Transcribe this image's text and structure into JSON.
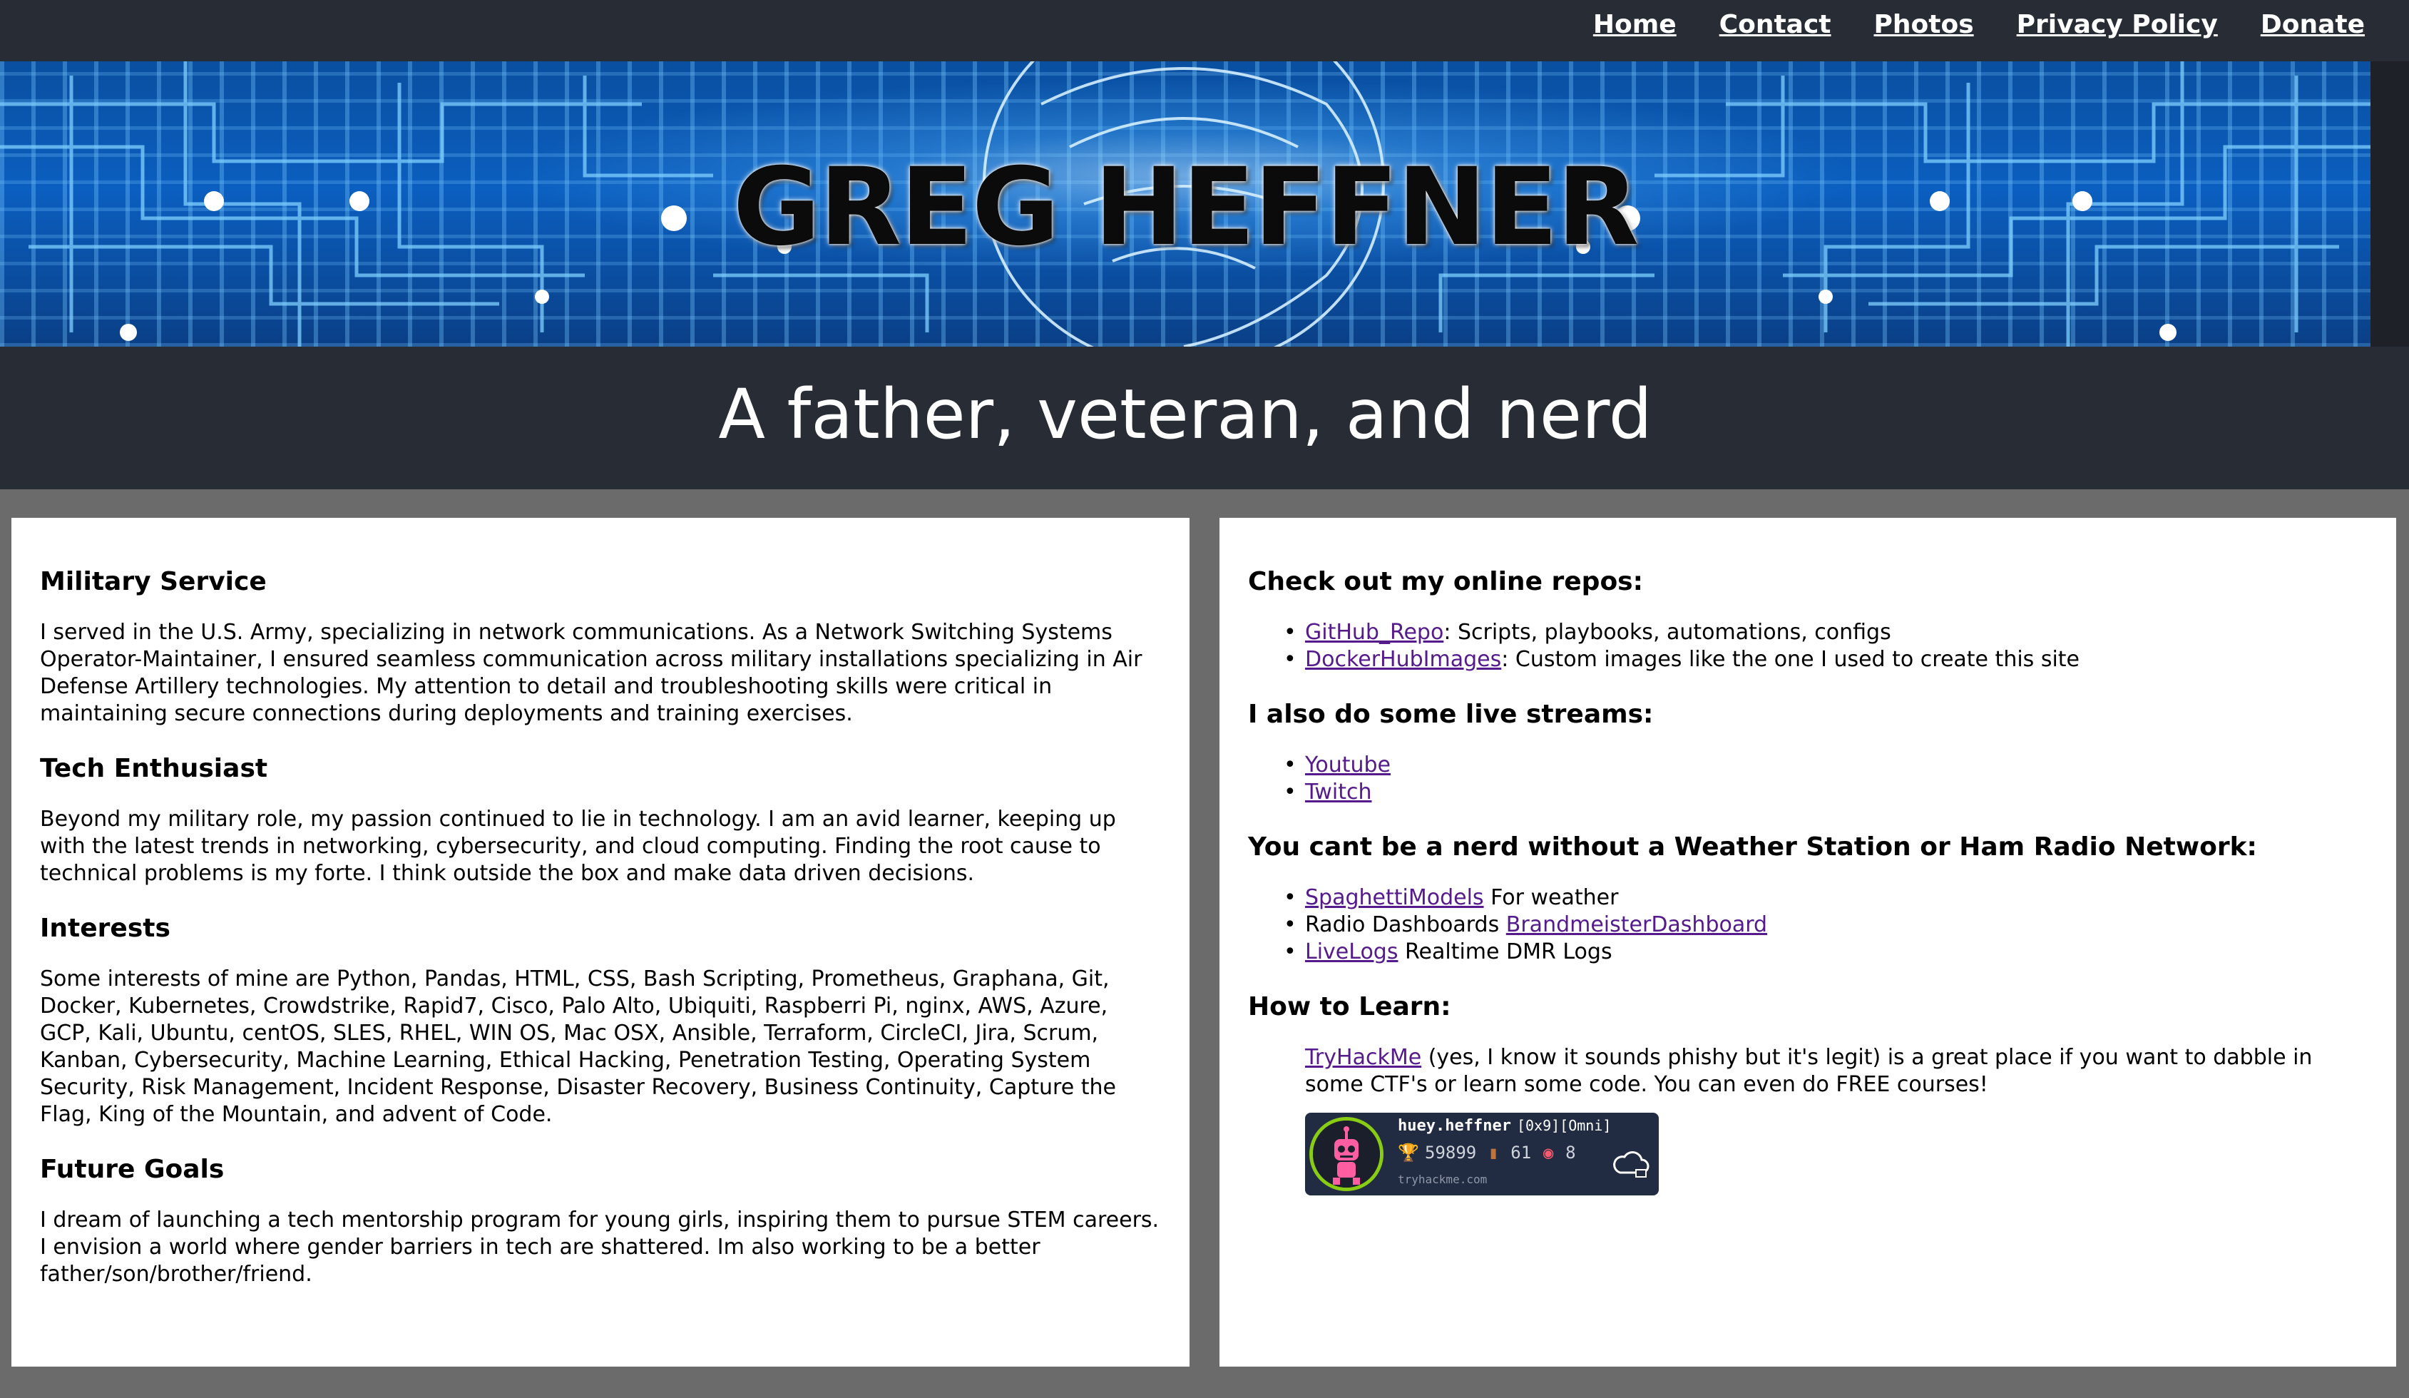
{
  "nav": {
    "items": [
      {
        "label": "Home"
      },
      {
        "label": "Contact"
      },
      {
        "label": "Photos"
      },
      {
        "label": "Privacy Policy"
      },
      {
        "label": "Donate"
      }
    ]
  },
  "header": {
    "title": "GREG HEFFNER",
    "tagline": "A father, veteran, and nerd"
  },
  "left": {
    "sections": [
      {
        "heading": "Military Service",
        "body": "I served in the U.S. Army, specializing in network communications. As a Network Switching Systems Operator-Maintainer, I ensured seamless communication across military installations specializing in Air Defense Artillery technologies. My attention to detail and troubleshooting skills were critical in maintaining secure connections during deployments and training exercises."
      },
      {
        "heading": "Tech Enthusiast",
        "body": "Beyond my military role, my passion continued to lie in technology. I am an avid learner, keeping up with the latest trends in networking, cybersecurity, and cloud computing. Finding the root cause to technical problems is my forte. I think outside the box and make data driven decisions."
      },
      {
        "heading": "Interests",
        "body": "Some interests of mine are Python, Pandas, HTML, CSS, Bash Scripting, Prometheus, Graphana, Git, Docker, Kubernetes, Crowdstrike, Rapid7, Cisco, Palo Alto, Ubiquiti, Raspberri Pi, nginx, AWS, Azure, GCP, Kali, Ubuntu, centOS, SLES, RHEL, WIN OS, Mac OSX, Ansible, Terraform, CircleCI, Jira, Scrum, Kanban, Cybersecurity, Machine Learning, Ethical Hacking, Penetration Testing, Operating System Security, Risk Management, Incident Response, Disaster Recovery, Business Continuity, Capture the Flag, King of the Mountain, and advent of Code."
      },
      {
        "heading": "Future Goals",
        "body": "I dream of launching a tech mentorship program for young girls, inspiring them to pursue STEM careers. I envision a world where gender barriers in tech are shattered. Im also working to be a better father/son/brother/friend."
      }
    ]
  },
  "right": {
    "repos": {
      "heading": "Check out my online repos:",
      "items": [
        {
          "link": "GitHub_Repo",
          "text": ": Scripts, playbooks, automations, configs"
        },
        {
          "link": "DockerHubImages",
          "text": ": Custom images like the one I used to create this site"
        }
      ]
    },
    "streams": {
      "heading": "I also do some live streams:",
      "items": [
        {
          "link": "Youtube"
        },
        {
          "link": "Twitch"
        }
      ]
    },
    "weather": {
      "heading": "You cant be a nerd without a Weather Station or Ham Radio Network:",
      "items": [
        {
          "pre": "",
          "link": "SpaghettiModels",
          "text": " For weather"
        },
        {
          "pre": "Radio Dashboards ",
          "link": "BrandmeisterDashboard",
          "text": ""
        },
        {
          "pre": "",
          "link": "LiveLogs",
          "text": " Realtime DMR Logs"
        }
      ]
    },
    "learn": {
      "heading": "How to Learn:",
      "link": "TryHackMe",
      "text": " (yes, I know it sounds phishy but it's legit) is a great place if you want to dabble in some CTF's or learn some code. You can even do FREE courses!"
    },
    "badge": {
      "username": "huey.heffner",
      "rank": "[0x9][Omni]",
      "points": "59899",
      "rooms": "61",
      "badges": "8",
      "site": "tryhackme.com",
      "avatar_icon": "pink-robot-avatar-icon",
      "trophy_icon": "trophy-icon",
      "door_icon": "door-icon",
      "target_icon": "target-icon",
      "cloud_icon": "cloud-icon"
    }
  },
  "colors": {
    "nav_bg": "#282c34",
    "content_bg": "#6b6b6b",
    "panel_bg": "#ffffff",
    "visited_link": "#551a8b",
    "badge_bg": "#212c42",
    "badge_ring": "#88cc14"
  }
}
